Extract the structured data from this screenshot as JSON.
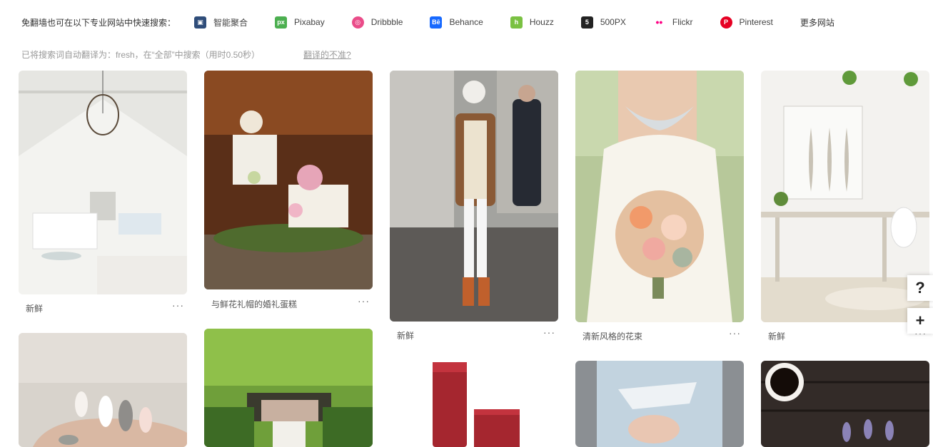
{
  "topbar": {
    "intro": "免翻墙也可在以下专业网站中快速搜索：",
    "sites": [
      {
        "label": "智能聚合",
        "icon": "smart-aggregate-icon",
        "color": "#2f4d7a",
        "glyph": "▣"
      },
      {
        "label": "Pixabay",
        "icon": "pixabay-icon",
        "color": "#4caf50",
        "glyph": "px"
      },
      {
        "label": "Dribbble",
        "icon": "dribbble-icon",
        "color": "#ea4c89",
        "glyph": "◎"
      },
      {
        "label": "Behance",
        "icon": "behance-icon",
        "color": "#1769ff",
        "glyph": "Bē"
      },
      {
        "label": "Houzz",
        "icon": "houzz-icon",
        "color": "#7ac142",
        "glyph": "h"
      },
      {
        "label": "500PX",
        "icon": "500px-icon",
        "color": "#222222",
        "glyph": "5"
      },
      {
        "label": "Flickr",
        "icon": "flickr-icon",
        "color": "#ff0084",
        "glyph": "••"
      },
      {
        "label": "Pinterest",
        "icon": "pinterest-icon",
        "color": "#e60023",
        "glyph": "P"
      }
    ],
    "more": "更多网站"
  },
  "translate": {
    "text": "已将搜索词自动翻译为：fresh，在“全部”中搜索（用时0.50秒）",
    "link": "翻译的不准?"
  },
  "cards": [
    {
      "caption": "新鲜",
      "dots": "···",
      "kind": "white-living-room",
      "colors": [
        "#f1f1ef",
        "#d8d8d4"
      ]
    },
    {
      "caption": "与鲜花礼帽的婚礼蛋糕",
      "dots": "···",
      "kind": "wedding-cake",
      "colors": [
        "#6b3a1f",
        "#2a1a0f"
      ]
    },
    {
      "caption": "新鲜",
      "dots": "···",
      "kind": "street-fashion",
      "colors": [
        "#9a9a98",
        "#4c4c4c"
      ]
    },
    {
      "caption": "清新风格的花束",
      "dots": "···",
      "kind": "bridal-bouquet",
      "colors": [
        "#b8cfa0",
        "#f4efe4"
      ]
    },
    {
      "caption": "新鲜",
      "dots": "···",
      "kind": "white-desk-room",
      "colors": [
        "#f2f1ee",
        "#e0ddd5"
      ]
    },
    {
      "caption": "",
      "dots": "",
      "kind": "nails",
      "colors": [
        "#d8d2ca",
        "#b6aea4"
      ]
    },
    {
      "caption": "",
      "dots": "",
      "kind": "garden",
      "colors": [
        "#7fae3f",
        "#335a22"
      ]
    },
    {
      "caption": "",
      "dots": "",
      "kind": "lipstick",
      "colors": [
        "#ffffff",
        "#a5262f"
      ]
    },
    {
      "caption": "",
      "dots": "",
      "kind": "ripped-jeans",
      "colors": [
        "#c6d4de",
        "#8aa2b6"
      ]
    },
    {
      "caption": "",
      "dots": "",
      "kind": "coffee-lavender",
      "colors": [
        "#3b3330",
        "#221b18"
      ]
    }
  ],
  "float": {
    "help": "?",
    "add": "+"
  }
}
